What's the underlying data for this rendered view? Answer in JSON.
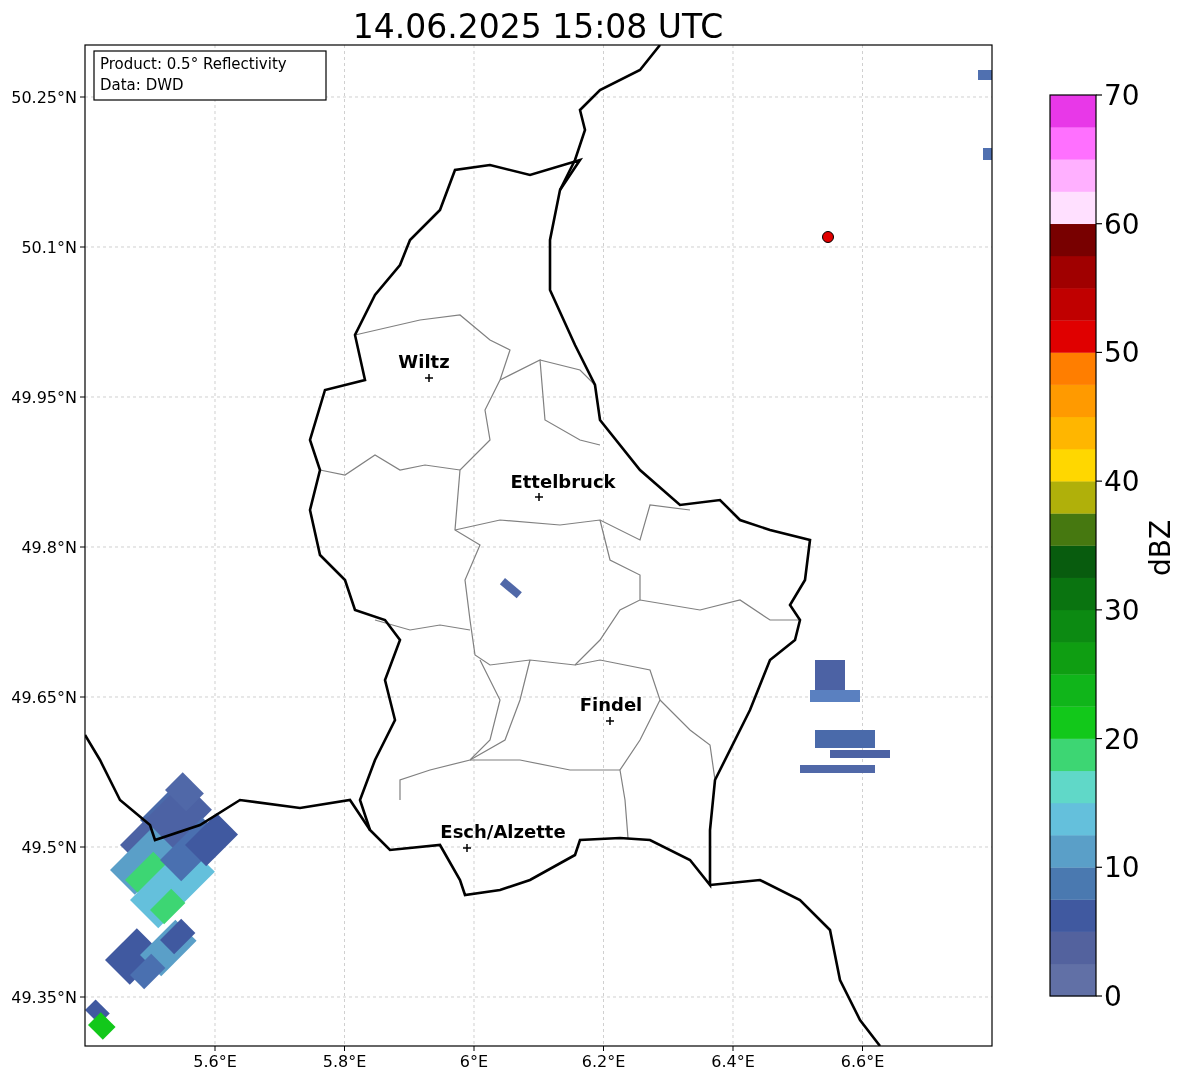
{
  "title": "14.06.2025 15:08 UTC",
  "info_box": {
    "lines": [
      "Product: 0.5° Reflectivity",
      "Data: DWD"
    ]
  },
  "map": {
    "x_ticks": [
      "5.6°E",
      "5.8°E",
      "6°E",
      "6.2°E",
      "6.4°E",
      "6.6°E"
    ],
    "y_ticks": [
      "50.25°N",
      "50.1°N",
      "49.95°N",
      "49.8°N",
      "49.65°N",
      "49.5°N",
      "49.35°N"
    ],
    "cities": [
      {
        "name": "Wiltz"
      },
      {
        "name": "Ettelbruck"
      },
      {
        "name": "Findel"
      },
      {
        "name": "Esch/Alzette"
      }
    ]
  },
  "colorbar": {
    "label": "dBZ",
    "ticks": [
      "70",
      "60",
      "50",
      "40",
      "30",
      "20",
      "10",
      "0"
    ],
    "bins": [
      {
        "color": "#6170a6"
      },
      {
        "color": "#53629e"
      },
      {
        "color": "#4059a0"
      },
      {
        "color": "#4a79b0"
      },
      {
        "color": "#5a9fc8"
      },
      {
        "color": "#64c0dc"
      },
      {
        "color": "#60d8c8"
      },
      {
        "color": "#3dd673"
      },
      {
        "color": "#12c81a"
      },
      {
        "color": "#10b51a"
      },
      {
        "color": "#0f9e12"
      },
      {
        "color": "#0c8a12"
      },
      {
        "color": "#0a7410"
      },
      {
        "color": "#085c0e"
      },
      {
        "color": "#467810"
      },
      {
        "color": "#b0b00a"
      },
      {
        "color": "#ffd700"
      },
      {
        "color": "#ffb600"
      },
      {
        "color": "#ff9a00"
      },
      {
        "color": "#ff7e00"
      },
      {
        "color": "#e00000"
      },
      {
        "color": "#c00000"
      },
      {
        "color": "#a00000"
      },
      {
        "color": "#780000"
      },
      {
        "color": "#ffe0ff"
      },
      {
        "color": "#ffb0ff"
      },
      {
        "color": "#ff70ff"
      },
      {
        "color": "#e838e8"
      }
    ]
  }
}
